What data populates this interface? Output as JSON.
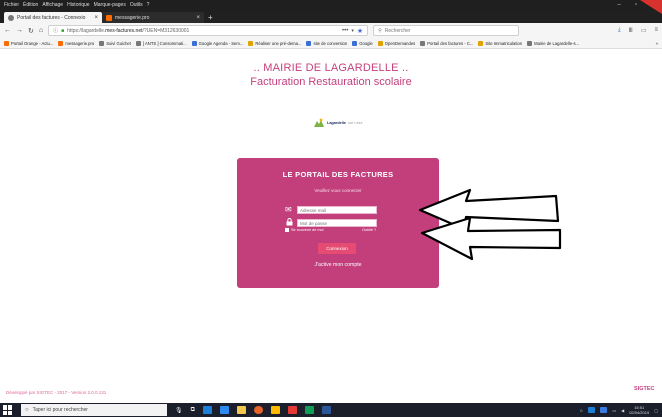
{
  "menu": [
    "Fichier",
    "Édition",
    "Affichage",
    "Historique",
    "Marque-pages",
    "Outils",
    "?"
  ],
  "window_controls": [
    "–",
    "▫",
    "✕"
  ],
  "tabs": [
    {
      "label": "Portail des factures - Connexio",
      "active": true
    },
    {
      "label": "messagerie.pro",
      "active": false
    }
  ],
  "new_tab": "+",
  "url": {
    "prefix": "https://lagardelle.",
    "host": "mes-factures.net",
    "path": "/?UEN=M312630001",
    "dots": "•••"
  },
  "search_placeholder": "Rechercher",
  "bookmarks": [
    {
      "label": "Portail Orange - Actu...",
      "color": "#ff6a00"
    },
    {
      "label": "messagerie.pro",
      "color": "#ff6a00"
    },
    {
      "label": "Suivi Guichet",
      "color": "#777777"
    },
    {
      "label": "[ ANTS ] Consommati...",
      "color": "#777777"
    },
    {
      "label": "Google Agenda - Sem...",
      "color": "#3b6fd6"
    },
    {
      "label": "Réaliser une pré-dema...",
      "color": "#e2a200"
    },
    {
      "label": "site de conversion",
      "color": "#3b6fd6"
    },
    {
      "label": "Google",
      "color": "#3b6fd6"
    },
    {
      "label": "OpenDemandes",
      "color": "#e2a200"
    },
    {
      "label": "Portail des factures - C...",
      "color": "#777777"
    },
    {
      "label": "Site Immatriculation",
      "color": "#e2a200"
    },
    {
      "label": "Mairie de Lagardelle-s...",
      "color": "#777777"
    }
  ],
  "header": {
    "title": ".. MAIRIE DE LAGARDELLE ..",
    "subtitle": "Facturation Restauration scolaire"
  },
  "logo": {
    "text": "Lagardelle",
    "suffix": "sur Lèze"
  },
  "login": {
    "title": "LE PORTAIL DES FACTURES",
    "subtitle": "Veuillez vous connecter",
    "email_placeholder": "Adresse mail",
    "password_placeholder": "Mot de passe",
    "remember": "Se souvenir de moi",
    "forgot": "Oublié ?",
    "button": "Connexion",
    "activate": "J'active mon compte"
  },
  "footer": {
    "left": "Développé par SIGTEC - 2017 - Version 2.0.0.131",
    "right": "SIGTEC"
  },
  "taskbar": {
    "search": "Taper ici pour rechercher",
    "time": "15:51",
    "date": "02/04/2019"
  },
  "colors": {
    "brand": "#c43f7d",
    "card": "#c23f7c",
    "button": "#e64b73",
    "page_bg": "#ffffff"
  }
}
